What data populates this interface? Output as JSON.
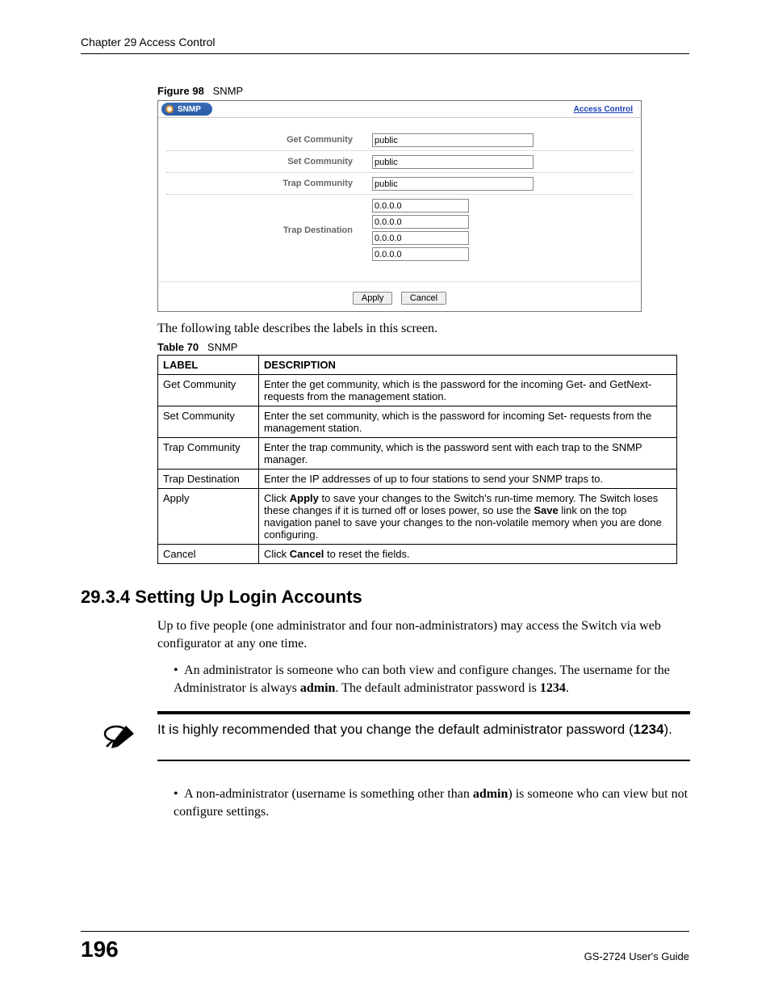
{
  "header": {
    "chapter": "Chapter 29 Access Control"
  },
  "figure": {
    "label": "Figure 98",
    "title": "SNMP"
  },
  "screenshot": {
    "panel_title": "SNMP",
    "breadcrumb": "Access Control",
    "fields": {
      "get_label": "Get Community",
      "get_value": "public",
      "set_label": "Set Community",
      "set_value": "public",
      "trap_label": "Trap Community",
      "trap_value": "public",
      "dest_label": "Trap Destination",
      "dest1": "0.0.0.0",
      "dest2": "0.0.0.0",
      "dest3": "0.0.0.0",
      "dest4": "0.0.0.0"
    },
    "buttons": {
      "apply": "Apply",
      "cancel": "Cancel"
    }
  },
  "intro_text": "The following table describes the labels in this screen.",
  "table": {
    "caption_label": "Table 70",
    "caption_title": "SNMP",
    "head": {
      "c1": "LABEL",
      "c2": "DESCRIPTION"
    },
    "rows": {
      "r1c1": "Get Community",
      "r1c2": "Enter the get community, which is the password for the incoming Get- and GetNext- requests from the management station.",
      "r2c1": "Set Community",
      "r2c2": "Enter the set community, which is the password for incoming Set- requests from the management station.",
      "r3c1": "Trap Community",
      "r3c2": "Enter the trap community, which is the password sent with each trap to the SNMP manager.",
      "r4c1": "Trap Destination",
      "r4c2": "Enter the IP addresses of up to four stations to send your SNMP traps to.",
      "r5c1": "Apply",
      "r5_click": "Click ",
      "r5_apply": "Apply",
      "r5_mid": " to save your changes to the Switch's run-time memory. The Switch loses these changes if it is turned off or loses power, so use the ",
      "r5_save": "Save",
      "r5_end": " link on the top navigation panel to save your changes to the non-volatile memory when you are done configuring.",
      "r6c1": "Cancel",
      "r6_click": "Click ",
      "r6_cancel": "Cancel",
      "r6_end": " to reset the fields."
    }
  },
  "section": {
    "num_title": "29.3.4  Setting Up Login Accounts",
    "p1": "Up to five people (one administrator and four non-administrators) may access the Switch via web configurator at any one time.",
    "b1_pre": "An administrator is someone who can both view and configure changes. The username for the Administrator is always ",
    "b1_admin": "admin",
    "b1_mid": ". The default administrator password is ",
    "b1_pw": "1234",
    "b1_end": ".",
    "note_pre": "It is highly recommended that you change the default administrator password (",
    "note_pw": "1234",
    "note_end": ").",
    "b2_pre": " A non-administrator (username is something other than ",
    "b2_admin": "admin",
    "b2_end": ") is someone who can view but not configure settings."
  },
  "footer": {
    "page": "196",
    "guide": "GS-2724 User's Guide"
  }
}
